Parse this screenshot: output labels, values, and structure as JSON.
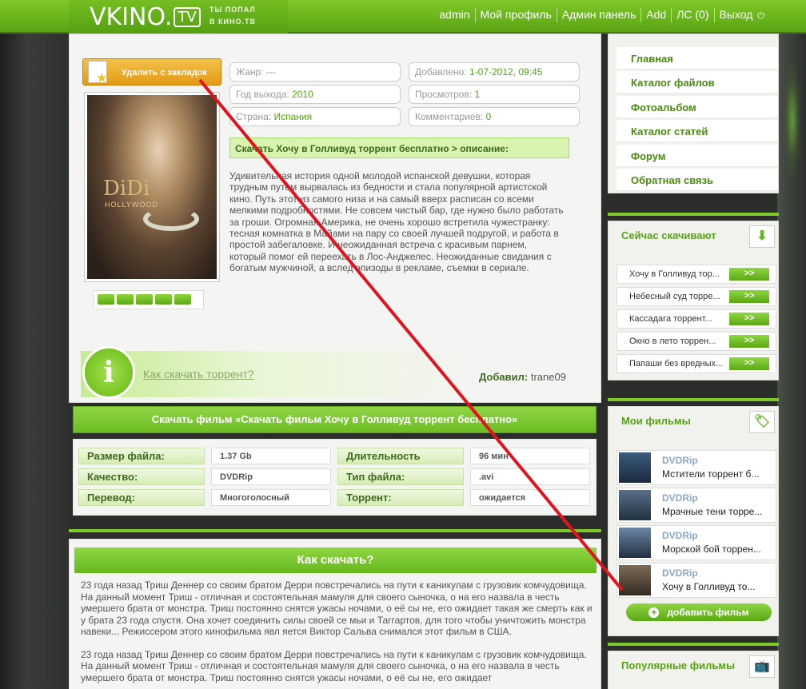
{
  "header": {
    "logo": "VKINO.",
    "logo_tv": "TV",
    "slogan_line1": "ты попал",
    "slogan_line2": "в кино.тв",
    "nav": [
      "admin",
      "Мой профиль",
      "Админ панель",
      "Add",
      "ЛС (0)",
      "Выход"
    ]
  },
  "movie": {
    "bookmark_button": "Удалить с закладок",
    "poster_title": "DiDi",
    "poster_sub": "HOLLYWOOD",
    "rating_value": 0,
    "info": {
      "genre_label": "Жанр:",
      "genre_value": "---",
      "year_label": "Год выхода:",
      "year_value": "2010",
      "country_label": "Страна:",
      "country_value": "Испания",
      "added_label": "Добавлено:",
      "added_value": "1-07-2012, 09:45",
      "views_label": "Просмотров:",
      "views_value": "1",
      "comments_label": "Комментариев:",
      "comments_value": "0"
    },
    "desc_heading": "Скачать Хочу в Голливуд торрент бесплатно > описание:",
    "description": "Удивительная история одной молодой испанской девушки, которая трудным путем вырвалась из бедности и стала популярной артистской кино. Путь этот из самого низа и на самый вверх расписан со всеми мелкими подробностями. Не совсем чистый бар, где нужно было работать за гроши. Огромная Америка, не очень хорошо встретила чужестранку: тесная комнатка в Майами на пару со своей лучшей подругой, и работа в простой забегаловке. И неожиданная встреча с красивым парнем, который помог ей переехать в Лос-Анджелес. Неожиданные свидания с богатым мужчиной, а вслед эпизоды в рекламе, съемки в сериале.",
    "howto_link": "Как скачать торрент?",
    "added_by_label": "Добавил:",
    "added_by_value": "trane09",
    "download_button": "Скачать фильм «Скачать фильм Хочу в Голливуд торрент бесплатно»",
    "specs": {
      "size_label": "Размер файла:",
      "size_value": "1.37 Gb",
      "duration_label": "Длительность",
      "duration_value": "96 мин",
      "quality_label": "Качество:",
      "quality_value": "DVDRip",
      "filetype_label": "Тип файла:",
      "filetype_value": ".avi",
      "translation_label": "Перевод:",
      "translation_value": "Многоголосный",
      "torrent_label": "Торрент:",
      "torrent_value": "ожидается"
    }
  },
  "howto": {
    "title": "Как скачать?",
    "para1": "23 года назад Триш Деннер со своим братом Дерри повстречались на пути к каникулам с грузовик комчудовища. На данный момент Триш - отличная и состоятельная мамуля для своего сыночка, о на его назвала в честь умершего брата от монстра. Триш постоянно снятся ужасы ночами, о её сы не, его ожидает такая же смерть как и у брата 23 года спустя. Она хочет соединить силы своей се мьи и Таггартов, для того чтобы уничтожить монстра навеки... Режиссером этого кинофильма явл яется Виктор Сальва снимался этот фильм в США.",
    "para2": "23 года назад Триш Деннер со своим братом Дерри повстречались на пути к каникулам с грузовик комчудовища. На данный момент Триш - отличная и состоятельная мамуля для своего сыночка, о на его назвала в честь умершего брата от монстра. Триш постоянно снятся ужасы ночами, о её сы не, его ожидает"
  },
  "sidebar": {
    "nav": [
      "Главная",
      "Каталог файлов",
      "Фотоальбом",
      "Каталог статей",
      "Форум",
      "Обратная связь"
    ],
    "downloading": {
      "title": "Сейчас скачивают",
      "go_label": ">>",
      "items": [
        "Хочу в Голливуд тор...",
        "Небесный суд торре...",
        "Кассадага торрент...",
        "Окно в лето торрен...",
        "Папаши без вредных..."
      ]
    },
    "my_films": {
      "title": "Мои фильмы",
      "items": [
        {
          "quality": "DVDRip",
          "title": "Мстители торрент б..."
        },
        {
          "quality": "DVDRip",
          "title": "Мрачные тени торре..."
        },
        {
          "quality": "DVDRip",
          "title": "Морской бой торрен..."
        },
        {
          "quality": "DVDRip",
          "title": "Хочу в Голливуд то..."
        }
      ],
      "add_button": "добавить фильм"
    },
    "popular": {
      "title": "Популярные фильмы"
    }
  },
  "colors": {
    "accent": "#6cbd23",
    "dark_green": "#3f6a1f",
    "annotation": "#e0141e"
  }
}
